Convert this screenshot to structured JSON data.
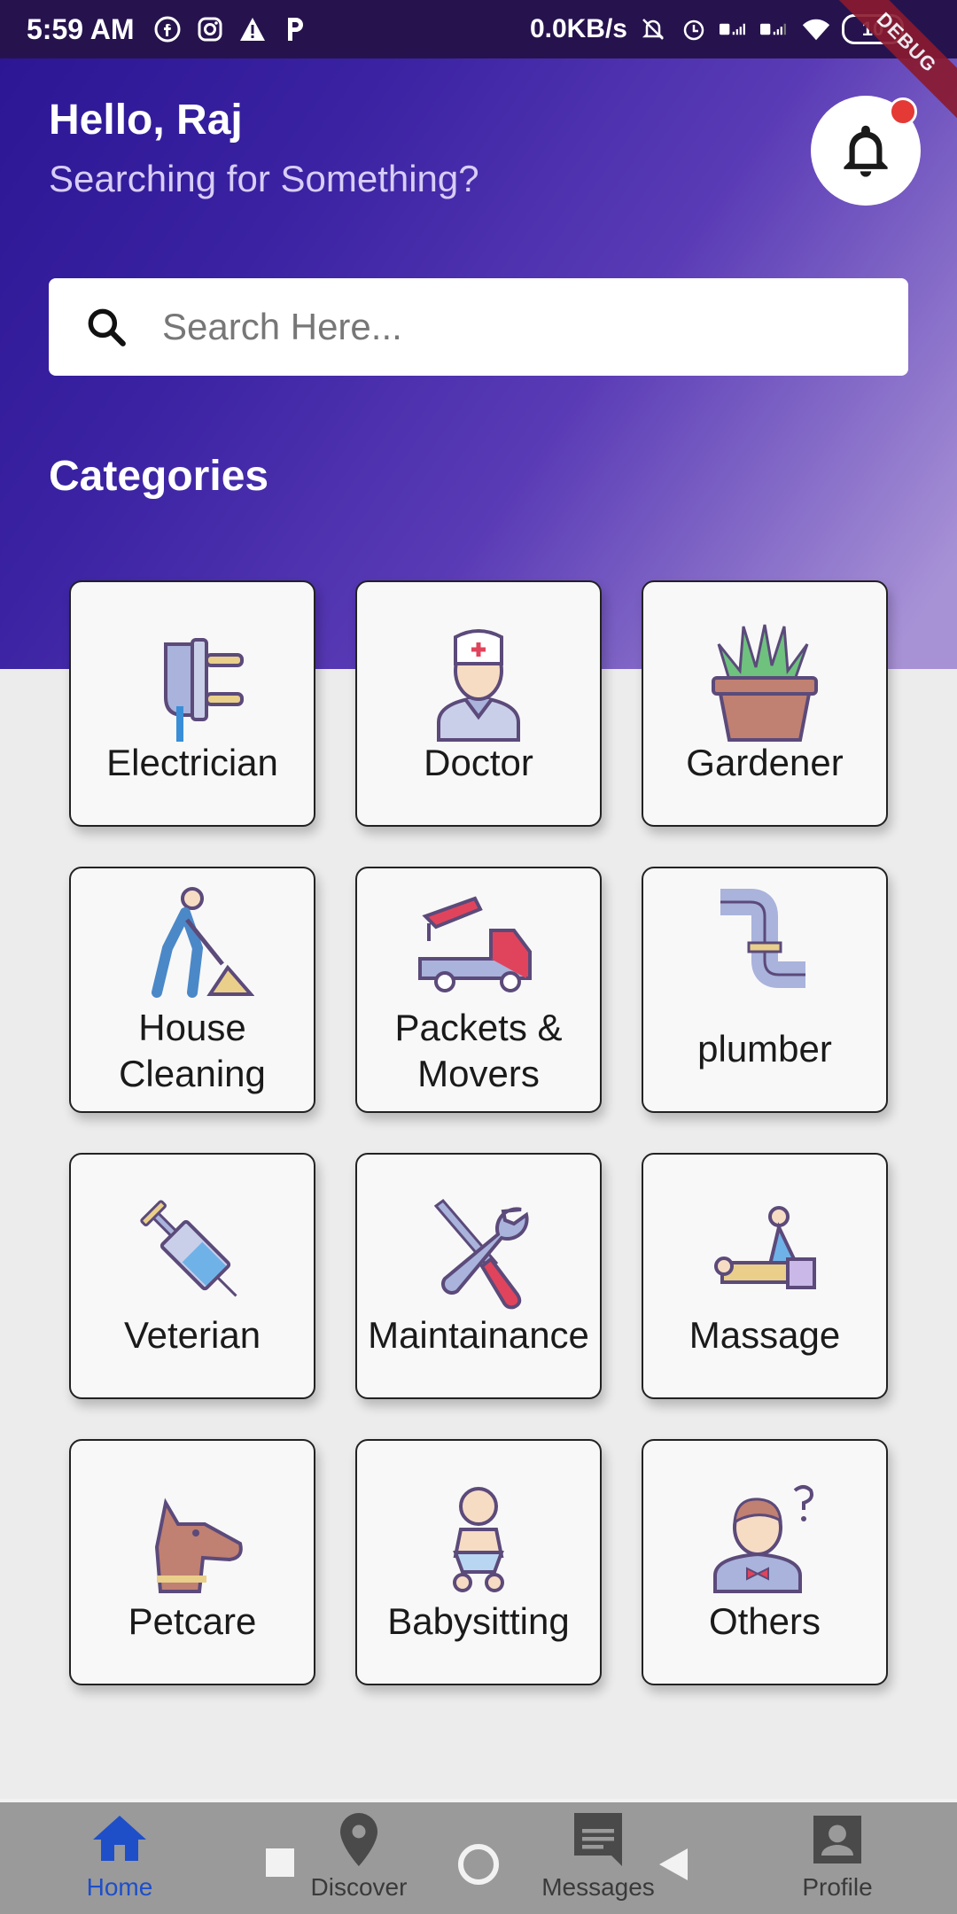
{
  "status_bar": {
    "time": "5:59 AM",
    "net_speed": "0.0KB/s",
    "battery": "10",
    "debug_label": "DEBUG"
  },
  "header": {
    "greeting": "Hello, Raj",
    "subtitle": "Searching for Something?"
  },
  "search": {
    "placeholder": "Search Here..."
  },
  "categories": {
    "title": "Categories",
    "items": [
      {
        "label": "Electrician",
        "icon": "plug-icon"
      },
      {
        "label": "Doctor",
        "icon": "doctor-icon"
      },
      {
        "label": "Gardener",
        "icon": "plant-pot-icon"
      },
      {
        "label": "House Cleaning",
        "icon": "worker-shovel-icon"
      },
      {
        "label": "Packets & Movers",
        "icon": "tow-truck-icon"
      },
      {
        "label": "plumber",
        "icon": "pipe-icon"
      },
      {
        "label": "Veterian",
        "icon": "syringe-icon"
      },
      {
        "label": "Maintainance",
        "icon": "wrench-screwdriver-icon"
      },
      {
        "label": "Massage",
        "icon": "massage-icon"
      },
      {
        "label": "Petcare",
        "icon": "dog-icon"
      },
      {
        "label": "Babysitting",
        "icon": "baby-icon"
      },
      {
        "label": "Others",
        "icon": "person-question-icon"
      }
    ]
  },
  "bottom_nav": {
    "items": [
      {
        "label": "Home",
        "icon": "home-icon",
        "active": true
      },
      {
        "label": "Discover",
        "icon": "location-pin-icon",
        "active": false
      },
      {
        "label": "Messages",
        "icon": "message-icon",
        "active": false
      },
      {
        "label": "Profile",
        "icon": "profile-icon",
        "active": false
      }
    ]
  },
  "colors": {
    "header_gradient_start": "#2b1592",
    "header_gradient_end": "#a892d6",
    "active_nav": "#1e4fc9",
    "notification_dot": "#e53935"
  }
}
